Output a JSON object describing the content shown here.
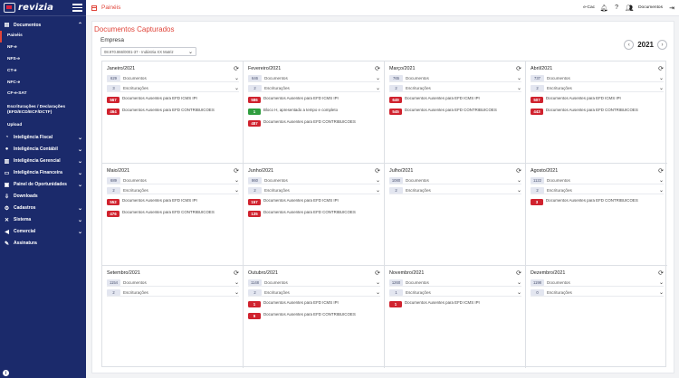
{
  "brand": {
    "name": "revizia"
  },
  "sidebar": {
    "documentos_label": "Documentos",
    "sub_items": [
      "Painéis",
      "NF-e",
      "NFS-e",
      "CT-e",
      "NFC-e",
      "CF-e-SAT",
      "Escriturações / Declarações (EFD/ECD/ECF/DCTF)",
      "Upload"
    ],
    "items": [
      {
        "label": "Inteligência Fiscal",
        "icon": "pie-chart-icon",
        "chevron": true
      },
      {
        "label": "Inteligência Contábil",
        "icon": "piggy-bank-icon",
        "chevron": true
      },
      {
        "label": "Inteligência Gerencial",
        "icon": "bar-chart-icon",
        "chevron": true
      },
      {
        "label": "Inteligência Financeira",
        "icon": "money-icon",
        "chevron": true
      },
      {
        "label": "Painel de Oportunidades",
        "icon": "panel-icon",
        "chevron": true
      },
      {
        "label": "Downloads",
        "icon": "download-icon",
        "chevron": false
      },
      {
        "label": "Cadastros",
        "icon": "gear-icon",
        "chevron": true
      },
      {
        "label": "Sistema",
        "icon": "tools-icon",
        "chevron": true
      },
      {
        "label": "Comercial",
        "icon": "megaphone-icon",
        "chevron": true
      },
      {
        "label": "Assinatura",
        "icon": "signature-icon",
        "chevron": false
      }
    ]
  },
  "topbar": {
    "breadcrumb": "Painéis",
    "ecac": "e-Cac",
    "documents": "Documentos"
  },
  "main": {
    "title": "Documentos Capturados",
    "company_label": "Empresa",
    "company_value": "08.970.866/0001-37 - Indústria XX Matriz",
    "year": "2021"
  },
  "labels": {
    "documentos": "Documentos",
    "escrituracoes": "Escriturações"
  },
  "colors": {
    "primary": "#1b2a6b",
    "accent": "#e0453a",
    "badge_red": "#d0222e",
    "badge_green": "#2f9e3f"
  },
  "months": [
    {
      "name": "Janeiro/2021",
      "docs": "629",
      "escr": "3",
      "alerts": [
        {
          "value": "567",
          "color": "red",
          "text": "Documentos Ausentes para EFD ICMS IPI"
        },
        {
          "value": "464",
          "color": "red",
          "text": "Documentos Ausentes para EFD CONTRIBUICOES"
        }
      ]
    },
    {
      "name": "Fevereiro/2021",
      "docs": "646",
      "escr": "2",
      "alerts": [
        {
          "value": "586",
          "color": "red",
          "text": "Documentos Ausentes para EFD ICMS IPI"
        },
        {
          "value": "1",
          "color": "green",
          "text": "Bloco H, apresentado a tempo e completo"
        },
        {
          "value": "487",
          "color": "red",
          "text": "Documentos Ausentes para EFD CONTRIBUICOES"
        }
      ]
    },
    {
      "name": "Março/2021",
      "docs": "765",
      "escr": "2",
      "alerts": [
        {
          "value": "649",
          "color": "red",
          "text": "Documentos Ausentes para EFD ICMS IPI"
        },
        {
          "value": "545",
          "color": "red",
          "text": "Documentos Ausentes para EFD CONTRIBUICOES"
        }
      ]
    },
    {
      "name": "Abril/2021",
      "docs": "737",
      "escr": "2",
      "alerts": [
        {
          "value": "507",
          "color": "red",
          "text": "Documentos Ausentes para EFD ICMS IPI"
        },
        {
          "value": "443",
          "color": "red",
          "text": "Documentos Ausentes para EFD CONTRIBUICOES"
        }
      ]
    },
    {
      "name": "Maio/2021",
      "docs": "689",
      "escr": "2",
      "alerts": [
        {
          "value": "552",
          "color": "red",
          "text": "Documentos Ausentes para EFD ICMS IPI"
        },
        {
          "value": "476",
          "color": "red",
          "text": "Documentos Ausentes para EFD CONTRIBUICOES"
        }
      ]
    },
    {
      "name": "Junho/2021",
      "docs": "860",
      "escr": "2",
      "alerts": [
        {
          "value": "157",
          "color": "red",
          "text": "Documentos Ausentes para EFD ICMS IPI"
        },
        {
          "value": "135",
          "color": "red",
          "text": "Documentos Ausentes para EFD CONTRIBUICOES"
        }
      ]
    },
    {
      "name": "Julho/2021",
      "docs": "1080",
      "escr": "2",
      "alerts": []
    },
    {
      "name": "Agosto/2021",
      "docs": "1122",
      "escr": "2",
      "alerts": [
        {
          "value": "3",
          "color": "red",
          "text": "Documentos Ausentes para EFD CONTRIBUICOES"
        }
      ]
    },
    {
      "name": "Setembro/2021",
      "docs": "1154",
      "escr": "2",
      "alerts": []
    },
    {
      "name": "Outubro/2021",
      "docs": "1148",
      "escr": "2",
      "alerts": [
        {
          "value": "1",
          "color": "red",
          "text": "Documentos Ausentes para EFD ICMS IPI"
        },
        {
          "value": "9",
          "color": "red",
          "text": "Documentos Ausentes para EFD CONTRIBUICOES"
        }
      ]
    },
    {
      "name": "Novembro/2021",
      "docs": "1260",
      "escr": "1",
      "alerts": [
        {
          "value": "1",
          "color": "red",
          "text": "Documentos Ausentes para EFD ICMS IPI"
        }
      ]
    },
    {
      "name": "Dezembro/2021",
      "docs": "1198",
      "escr": "0",
      "alerts": []
    }
  ]
}
